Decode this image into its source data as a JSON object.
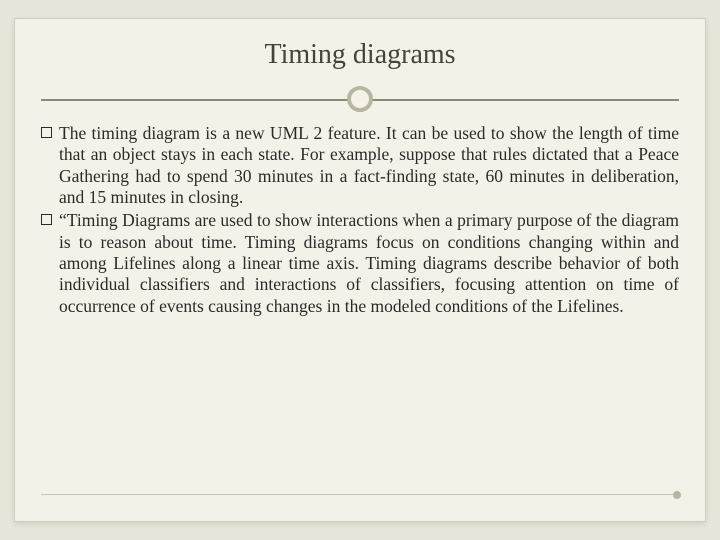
{
  "title": "Timing diagrams",
  "paragraphs": [
    "The timing diagram is a new UML 2 feature. It can be used to show the length of time that an object stays in each state. For example, suppose that rules dictated that a Peace Gathering had to spend 30 minutes in a fact-finding state, 60 minutes in deliberation, and 15 minutes in closing.",
    "“Timing Diagrams are used to show interactions when a primary purpose of the diagram is to reason about time. Timing diagrams  focus on conditions changing within and among Lifelines along a linear time axis. Timing diagrams describe behavior of both individual classifiers and interactions of classifiers, focusing attention on time of occurrence of events causing changes in the modeled conditions of the Lifelines."
  ]
}
